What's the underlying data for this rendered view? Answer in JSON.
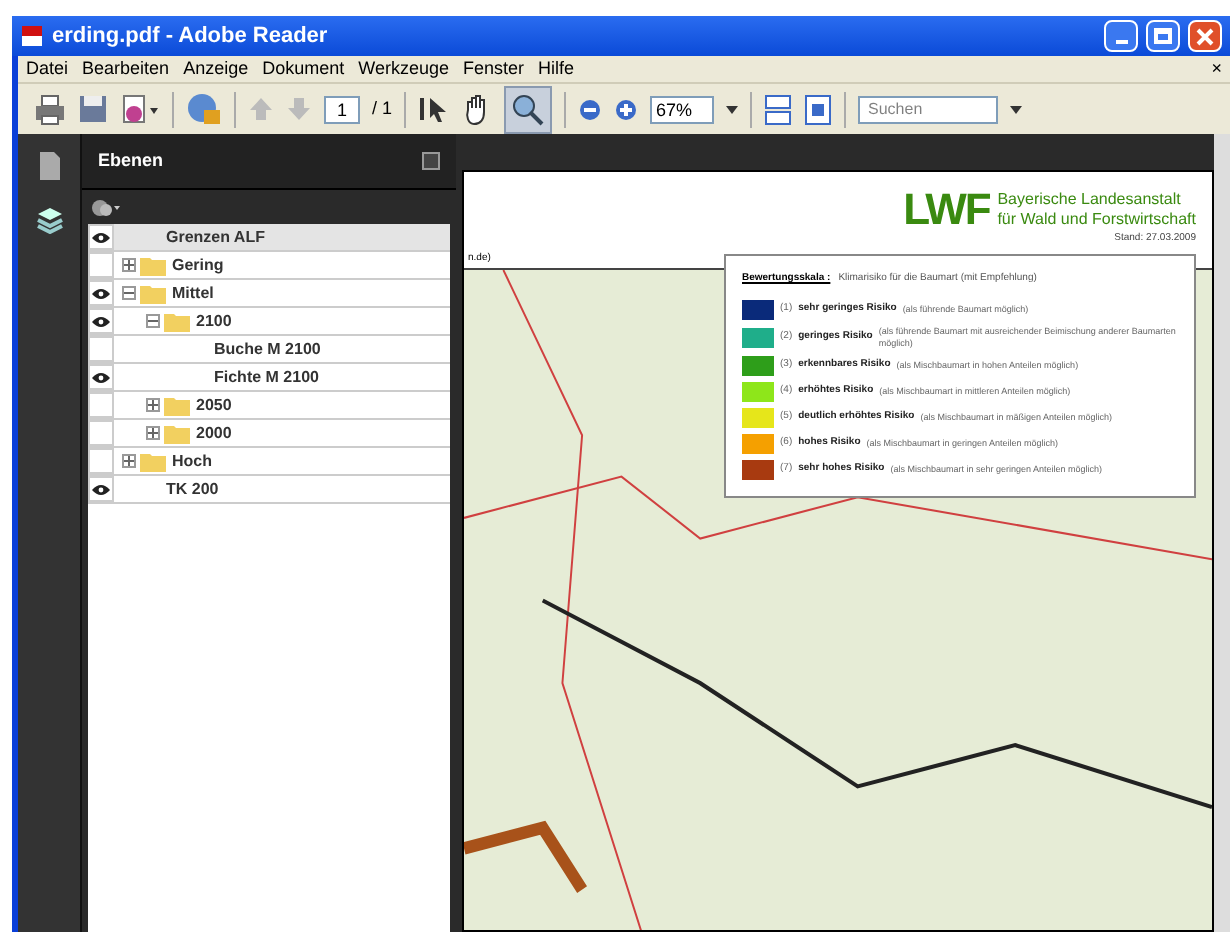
{
  "window": {
    "title": "erding.pdf - Adobe Reader"
  },
  "menu": [
    "Datei",
    "Bearbeiten",
    "Anzeige",
    "Dokument",
    "Werkzeuge",
    "Fenster",
    "Hilfe"
  ],
  "menu_close": "×",
  "toolbar": {
    "page": "1",
    "page_total": "/ 1",
    "zoom": "67%",
    "search_placeholder": "Suchen"
  },
  "layers_panel": {
    "title": "Ebenen",
    "layers": [
      {
        "label": "Grenzen ALF",
        "visible": true,
        "folder": false
      },
      {
        "label": "Gering",
        "visible": false,
        "folder": true,
        "expanded": false
      },
      {
        "label": "Mittel",
        "visible": true,
        "folder": true,
        "expanded": true,
        "children": [
          {
            "label": "2100",
            "visible": true,
            "folder": true,
            "expanded": true,
            "children": [
              {
                "label": "Buche M 2100",
                "visible": false,
                "folder": false
              },
              {
                "label": "Fichte M 2100",
                "visible": true,
                "folder": false
              }
            ]
          },
          {
            "label": "2050",
            "visible": false,
            "folder": true,
            "expanded": false
          },
          {
            "label": "2000",
            "visible": false,
            "folder": true,
            "expanded": false
          }
        ]
      },
      {
        "label": "Hoch",
        "visible": false,
        "folder": true,
        "expanded": false
      },
      {
        "label": "TK 200",
        "visible": true,
        "folder": false
      }
    ]
  },
  "document": {
    "url_fragment": "n.de)",
    "logo": "LWF",
    "institution": [
      "Bayerische Landesanstalt",
      "für Wald und Forstwirtschaft"
    ],
    "date": "Stand: 27.03.2009",
    "legend": {
      "title": "Bewertungsskala :",
      "subtitle": "Klimarisiko für die Baumart  (mit Empfehlung)",
      "items": [
        {
          "number": "(1)",
          "label": "sehr geringes Risiko",
          "note": "(als führende Baumart möglich)",
          "color": "#0a2a7a"
        },
        {
          "number": "(2)",
          "label": "geringes Risiko",
          "note": "(als führende Baumart mit ausreichender Beimischung anderer Baumarten möglich)",
          "color": "#1fae8a"
        },
        {
          "number": "(3)",
          "label": "erkennbares Risiko",
          "note": "(als Mischbaumart in hohen Anteilen möglich)",
          "color": "#2e9e1a"
        },
        {
          "number": "(4)",
          "label": "erhöhtes Risiko",
          "note": "(als Mischbaumart in mittleren Anteilen möglich)",
          "color": "#8ee61a"
        },
        {
          "number": "(5)",
          "label": "deutlich erhöhtes Risiko",
          "note": "(als Mischbaumart in mäßigen Anteilen möglich)",
          "color": "#e6e61a"
        },
        {
          "number": "(6)",
          "label": "hohes Risiko",
          "note": "(als Mischbaumart in geringen Anteilen möglich)",
          "color": "#f5a000"
        },
        {
          "number": "(7)",
          "label": "sehr hohes Risiko",
          "note": "(als Mischbaumart in sehr geringen Anteilen möglich)",
          "color": "#a83a10"
        }
      ]
    }
  }
}
